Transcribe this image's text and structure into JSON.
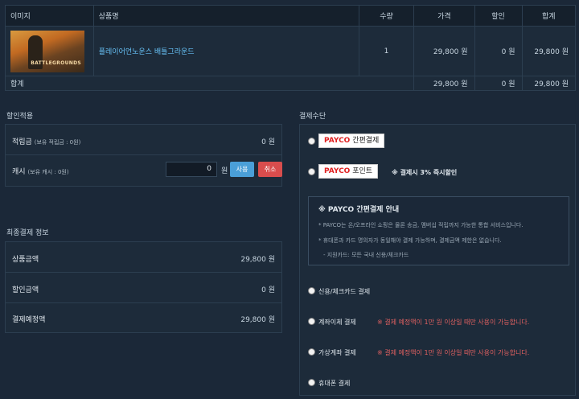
{
  "table": {
    "headers": [
      "이미지",
      "상품명",
      "수량",
      "가격",
      "할인",
      "합계"
    ],
    "item": {
      "name": "플레이어언노운스 배틀그라운드",
      "thumb_text": "BATTLEGROUNDS",
      "qty": "1",
      "price": "29,800 원",
      "discount": "0 원",
      "total": "29,800 원"
    },
    "sum": {
      "label": "합계",
      "price": "29,800 원",
      "discount": "0 원",
      "total": "29,800 원"
    }
  },
  "discount": {
    "title": "할인적용",
    "points_label": "적립금",
    "points_sub": "(보유 적립금 : 0원)",
    "points_value": "0 원",
    "cash_label": "캐시",
    "cash_sub": "(보유 캐시 : 0원)",
    "cash_input": "0",
    "cash_unit": "원",
    "use_label": "사용",
    "cancel_label": "취소"
  },
  "final": {
    "title": "최종결제 정보",
    "rows": [
      {
        "label": "상품금액",
        "value": "29,800 원"
      },
      {
        "label": "할인금액",
        "value": "0 원"
      },
      {
        "label": "결제예정액",
        "value": "29,800 원"
      }
    ]
  },
  "payment": {
    "title": "결제수단",
    "payco_brand": "PAYCO",
    "payco_easy": "간편결제",
    "payco_point": "포인트",
    "point_bonus": "※ 결제시 3% 즉시할인",
    "info_title": "※ PAYCO 간편결제 안내",
    "info_lines": [
      "* PAYCO는 온/오프라인 쇼핑은 물론 송금, 멤버십 적립까지 가능한 통합 서비스입니다.",
      "* 휴대폰과 카드 명의자가 동일해야 결제 가능하며, 결제금액 제한은 없습니다.",
      "- 지원카드: 모든 국내 신용/체크카드"
    ],
    "methods": [
      {
        "label": "신용/체크카드 결제",
        "note": ""
      },
      {
        "label": "계좌이체 결제",
        "note": "※ 결제 예정액이 1만 원 이상일 때만 사용이 가능합니다."
      },
      {
        "label": "가상계좌 결제",
        "note": "※ 결제 예정액이 1만 원 이상일 때만 사용이 가능합니다."
      },
      {
        "label": "휴대폰 결제",
        "note": ""
      }
    ]
  },
  "colors": {
    "background": "#1b2838",
    "link": "#66c0f4",
    "use_button": "#4a9fd8",
    "cancel_button": "#d94d4d",
    "warning": "#e06060"
  }
}
